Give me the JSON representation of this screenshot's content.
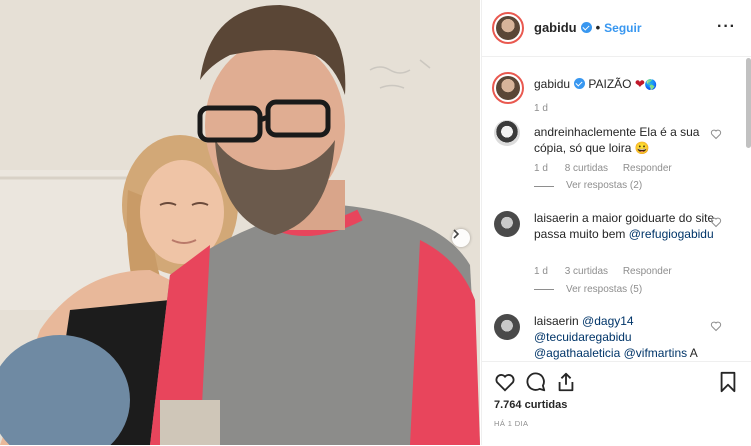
{
  "post": {
    "author": "gabidu",
    "follow_label": "Seguir",
    "separator": "•",
    "caption": {
      "username": "gabidu",
      "text": "PAIZÃO",
      "age": "1 d"
    },
    "comments": [
      {
        "username": "andreinhaclemente",
        "text": "Ela é a sua cópia, só que loira 😀",
        "age": "1 d",
        "likes": "8 curtidas",
        "reply": "Responder",
        "view_replies": "Ver respostas (2)"
      },
      {
        "username": "laisaerin",
        "text": "a maior goiduarte do site passa muito bem",
        "mention": "@refugiogabidu",
        "age": "1 d",
        "likes": "3 curtidas",
        "reply": "Responder",
        "view_replies": "Ver respostas (5)"
      },
      {
        "username": "laisaerin",
        "mention1": "@dagy14",
        "mention2": "@tecuidaregabidu",
        "mention3": "@agathaaleticia",
        "mention4": "@vifmartins",
        "tail": "A"
      }
    ],
    "likes_count": "7.764 curtidas",
    "time_ago": "HÁ 1 DIA"
  },
  "colors": {
    "accent": "#3897f0",
    "link": "#003569",
    "muted": "#8e8e8e",
    "story_ring": "#e95950"
  },
  "icons": [
    "more-icon",
    "heart-icon",
    "comment-icon",
    "share-icon",
    "bookmark-icon",
    "chevron-right-icon",
    "verified-icon"
  ]
}
